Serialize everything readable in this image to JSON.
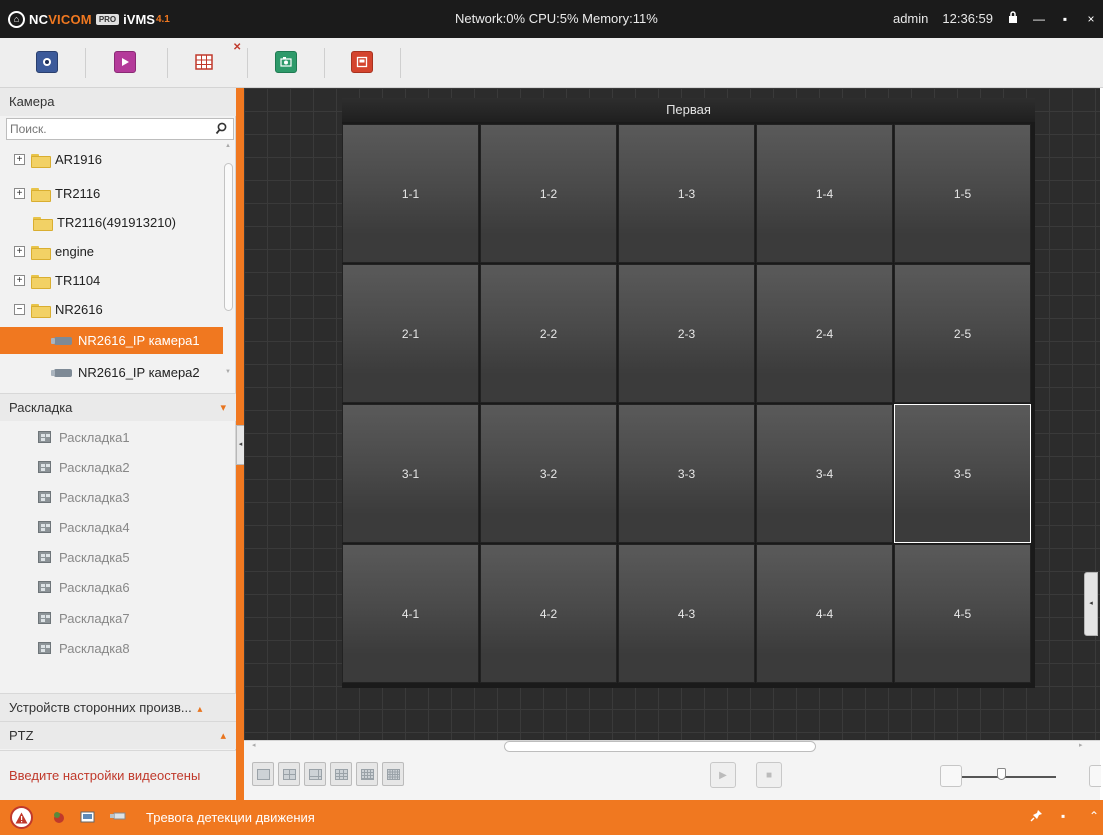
{
  "titlebar": {
    "logo_brand_a": "NC",
    "logo_brand_b": "VI",
    "logo_brand_c": "COM",
    "logo_pro": "PRO",
    "logo_vms": "iVMS",
    "logo_version": "4.1",
    "status": "Network:0% CPU:5% Memory:11%",
    "user": "admin",
    "time": "12:36:59"
  },
  "sidebar": {
    "camera_header": "Камера",
    "search_placeholder": "Поиск.",
    "tree": [
      {
        "label": "AR1916"
      },
      {
        "label": "TR2116"
      },
      {
        "label": "TR2116(491913210)"
      },
      {
        "label": "engine"
      },
      {
        "label": "TR1104"
      },
      {
        "label": "NR2616"
      },
      {
        "label": "NR2616_IP камера1"
      },
      {
        "label": "NR2616_IP камера2"
      }
    ],
    "layout_header": "Раскладка",
    "layouts": [
      "Раскладка1",
      "Раскладка2",
      "Раскладка3",
      "Раскладка4",
      "Раскладка5",
      "Раскладка6",
      "Раскладка7",
      "Раскладка8"
    ],
    "third_party_header": "Устройств сторонних произв...",
    "ptz_header": "PTZ",
    "video_wall_settings": "Введите настройки видеостены"
  },
  "wall": {
    "title": "Первая",
    "cells": [
      [
        "1-1",
        "1-2",
        "1-3",
        "1-4",
        "1-5"
      ],
      [
        "2-1",
        "2-2",
        "2-3",
        "2-4",
        "2-5"
      ],
      [
        "3-1",
        "3-2",
        "3-3",
        "3-4",
        "3-5"
      ],
      [
        "4-1",
        "4-2",
        "4-3",
        "4-4",
        "4-5"
      ]
    ],
    "selected_cell": "3-5"
  },
  "statusbar": {
    "alarm_text": "Тревога детекции движения"
  },
  "colors": {
    "accent": "#f07820",
    "titlebar": "#1b1b1b",
    "wall_background": "#2c2c2c"
  }
}
